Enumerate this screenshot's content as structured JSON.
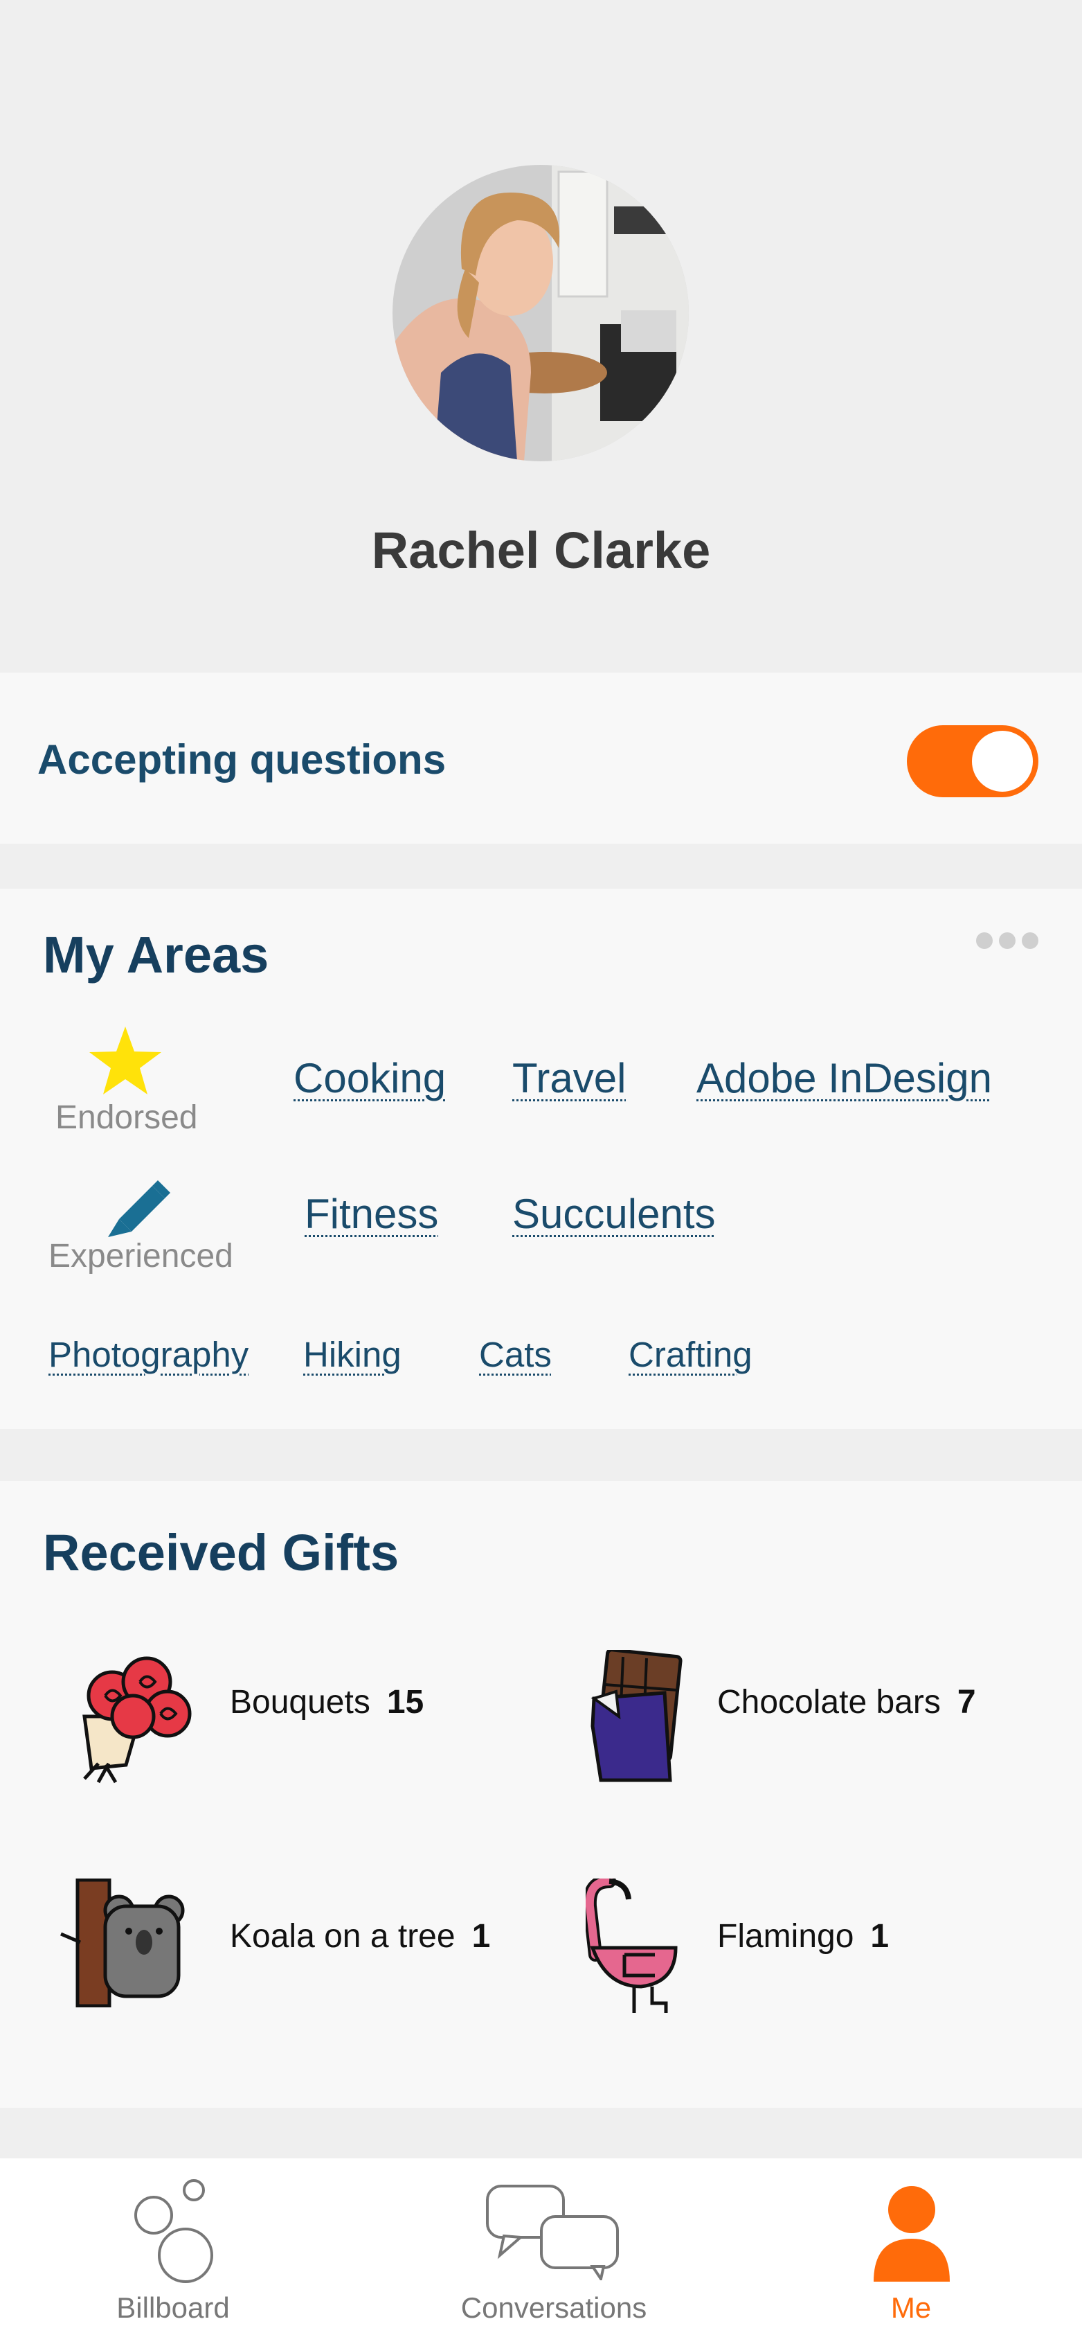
{
  "profile": {
    "name": "Rachel Clarke"
  },
  "availability": {
    "label": "Accepting questions",
    "enabled": true
  },
  "areas": {
    "title": "My Areas",
    "levels": {
      "endorsed": "Endorsed",
      "experienced": "Experienced"
    },
    "endorsed_tags": [
      "Cooking",
      "Travel",
      "Adobe InDesign"
    ],
    "experienced_tags": [
      "Fitness",
      "Succulents"
    ],
    "other_tags": [
      "Photography",
      "Hiking",
      "Cats",
      "Crafting"
    ]
  },
  "gifts": {
    "title": "Received Gifts",
    "items": [
      {
        "name": "Bouquets",
        "count": "15",
        "icon": "bouquet-icon"
      },
      {
        "name": "Chocolate bars",
        "count": "7",
        "icon": "chocolate-bar-icon"
      },
      {
        "name": "Koala on a tree",
        "count": "1",
        "icon": "koala-icon"
      },
      {
        "name": "Flamingo",
        "count": "1",
        "icon": "flamingo-icon"
      }
    ]
  },
  "nav": {
    "items": [
      {
        "label": "Billboard",
        "icon": "bubbles-icon",
        "active": false
      },
      {
        "label": "Conversations",
        "icon": "chat-icon",
        "active": false
      },
      {
        "label": "Me",
        "icon": "person-icon",
        "active": true
      }
    ]
  },
  "colors": {
    "accent": "#ff6b0a",
    "heading": "#163f5e",
    "tag": "#1a4b6b"
  }
}
